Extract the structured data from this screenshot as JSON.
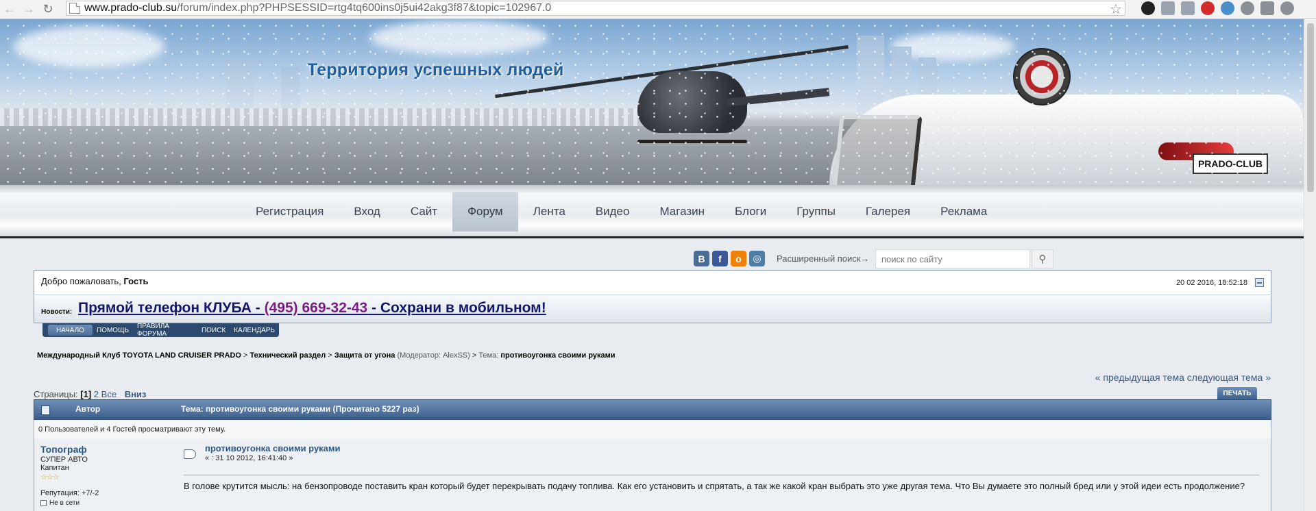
{
  "browser": {
    "url_host": "www.prado-club.su",
    "url_rest": "/forum/index.php?PHPSESSID=rtg4tq600ins0j5ui42akg3f87&topic=102967.0"
  },
  "banner": {
    "title": "Территория успешных людей",
    "plate": "PRADO-CLUB"
  },
  "menu": [
    {
      "label": "Регистрация"
    },
    {
      "label": "Вход"
    },
    {
      "label": "Сайт"
    },
    {
      "label": "Форум",
      "active": true
    },
    {
      "label": "Лента"
    },
    {
      "label": "Видео"
    },
    {
      "label": "Магазин"
    },
    {
      "label": "Блоги"
    },
    {
      "label": "Группы"
    },
    {
      "label": "Галерея"
    },
    {
      "label": "Реклама"
    }
  ],
  "social": [
    {
      "name": "vk",
      "glyph": "В",
      "color": "#4b6c95"
    },
    {
      "name": "facebook",
      "glyph": "f",
      "color": "#3b5998"
    },
    {
      "name": "odnoklassniki",
      "glyph": "о",
      "color": "#ee8208"
    },
    {
      "name": "instagram",
      "glyph": "◎",
      "color": "#4e7ea6"
    }
  ],
  "search": {
    "advanced": "Расширенный поиск→",
    "placeholder": "поиск по сайту"
  },
  "welcome": {
    "prefix": "Добро пожаловать, ",
    "user": "Гость",
    "datetime": "20 02 2016, 18:52:18"
  },
  "news": {
    "label": "Новости:",
    "text_a": "Прямой телефон КЛУБА - ",
    "phone": "(495) 669-32-43",
    "text_b": " - Сохрани в мобильном!"
  },
  "tabs": [
    {
      "label": "Начало",
      "active": true
    },
    {
      "label": "Помощь"
    },
    {
      "label": "Правила форума"
    },
    {
      "label": "Поиск"
    },
    {
      "label": "Календарь"
    }
  ],
  "breadcrumb": {
    "c1": "Международный Клуб TOYOTA LAND CRUISER PRADO",
    "c2": "Технический раздел",
    "c3": "Защита от угона",
    "moderator": "(Модератор: AlexSS)",
    "topic_prefix": "Тема:",
    "topic": "противоугонка своими руками",
    "sep": ">"
  },
  "topic_nav": {
    "text": "« предыдущая тема следующая тема »"
  },
  "pages": {
    "label": "Страницы:",
    "current": "[1]",
    "p2": "2",
    "all": "Все",
    "down": "Вниз"
  },
  "print_label": "ПЕЧАТЬ",
  "topic_header": {
    "author": "Автор",
    "topic": "Тема: противоугонка своими руками  (Прочитано 5227 раз)"
  },
  "viewers": "0 Пользователей и 4 Гостей просматривают эту тему.",
  "post": {
    "author": "Топограф",
    "group": "СУПЕР АВТО",
    "rank": "Капитан",
    "stars": "☆☆☆",
    "reputation": "Репутация: +7/-2",
    "status": "Не в сети",
    "title": "противоугонка своими руками",
    "date": "« : 31 10 2012, 16:41:40 »",
    "body": "В голове крутится мысль: на бензопроводе поставить кран который будет перекрывать подачу топлива. Как его установить и спрятать, а так же какой кран выбрать это уже другая тема.  Что Вы думаете это полный бред или у этой идеи есть продолжение?"
  },
  "colors": {
    "accent": "#3c5e8c",
    "link": "#2f5585",
    "news_phone": "#7a1e86"
  }
}
